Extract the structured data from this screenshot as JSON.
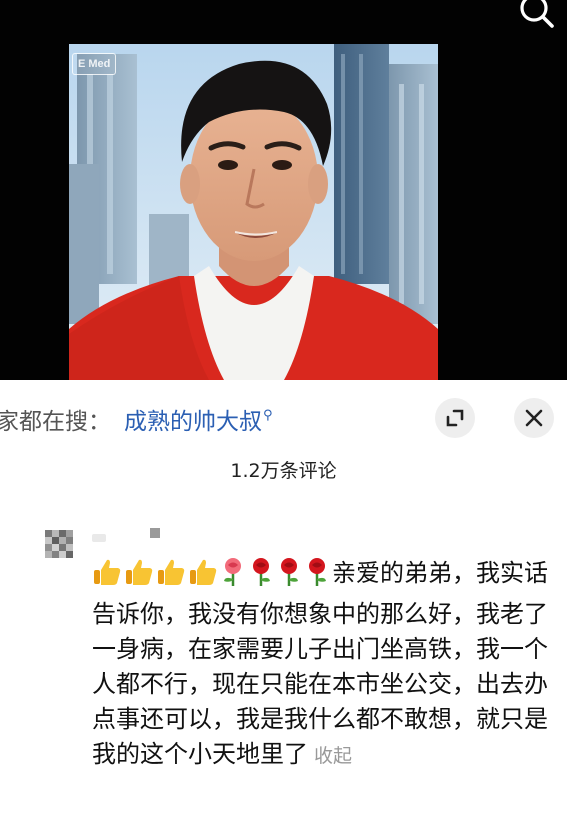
{
  "video": {
    "watermark_text": "E Med",
    "search_icon": "search-icon"
  },
  "search_suggestion": {
    "prefix": "家都在搜：",
    "query": "成熟的帅大叔",
    "query_icon": "search-icon",
    "expand_icon": "expand-icon",
    "close_icon": "close-icon"
  },
  "comments": {
    "count_label": "1.2万条评论",
    "items": [
      {
        "emoji_sequence": [
          "thumbs-up",
          "thumbs-up",
          "thumbs-up",
          "thumbs-up",
          "rose",
          "rose",
          "rose",
          "rose"
        ],
        "text": "亲爱的弟弟，我实话告诉你，我没有你想象中的那么好，我老了一身病，在家需要儿子出门坐高铁，我一个人都不行，现在只能在本市坐公交，出去办点事还可以，我是我什么都不敢想，就只是我的这个小天地里了",
        "collapse_label": "收起"
      }
    ]
  },
  "colors": {
    "link": "#2b5fb3",
    "muted": "#999999",
    "sweater_red": "#d9281e"
  }
}
